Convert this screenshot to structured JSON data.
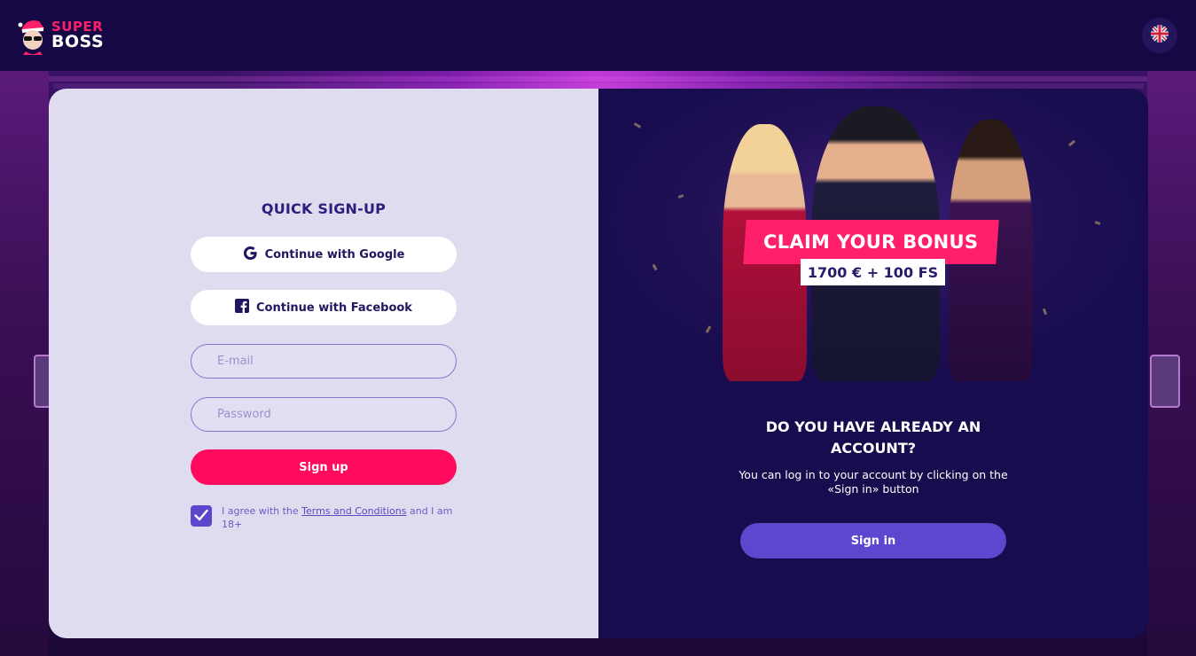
{
  "header": {
    "logo_line1": "SUPER",
    "logo_line2": "BOSS",
    "language_icon": "uk-flag-icon"
  },
  "signup": {
    "title": "QUICK SIGN-UP",
    "google_label": "Continue with Google",
    "facebook_label": "Continue with Facebook",
    "email_placeholder": "E-mail",
    "password_placeholder": "Password",
    "signup_label": "Sign up",
    "agree_prefix": "I agree with the ",
    "agree_link": "Terms and Conditions",
    "agree_suffix": " and I am 18+",
    "agree_checked": true
  },
  "promo": {
    "banner_title": "CLAIM YOUR BONUS",
    "banner_amount": "1700 € + 100 FS"
  },
  "account": {
    "title": "DO YOU HAVE ALREADY AN ACCOUNT?",
    "description": "You can log in to your account by clicking on the «Sign in» button",
    "signin_label": "Sign in"
  },
  "colors": {
    "brand_pink": "#ff0a5c",
    "brand_purple": "#5c48cf",
    "dark_navy": "#170c4e",
    "panel_light": "#dfdcf0"
  }
}
